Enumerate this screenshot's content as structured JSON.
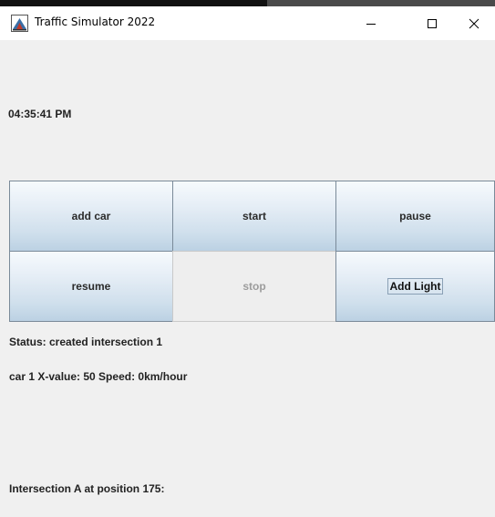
{
  "window": {
    "title": "Traffic Simulator 2022",
    "icon": "app-icon",
    "controls": [
      "minimize-icon",
      "maximize-icon",
      "close-icon"
    ]
  },
  "clock": {
    "time": "04:35:41 PM"
  },
  "buttons": {
    "add_car": "add car",
    "start": "start",
    "pause": "pause",
    "resume": "resume",
    "stop": "stop",
    "add_light": "Add Light"
  },
  "status": {
    "text": "Status: created intersection 1"
  },
  "cars": [
    {
      "text": "car 1 X-value: 50 Speed: 0km/hour"
    }
  ],
  "intersections": [
    {
      "text": "Intersection A at position 175:"
    }
  ],
  "colors": {
    "button_gradient_top": "#f6fafd",
    "button_gradient_bottom": "#bcd1e3",
    "background": "#f0f0f0",
    "disabled_text": "#9c9c9c"
  }
}
